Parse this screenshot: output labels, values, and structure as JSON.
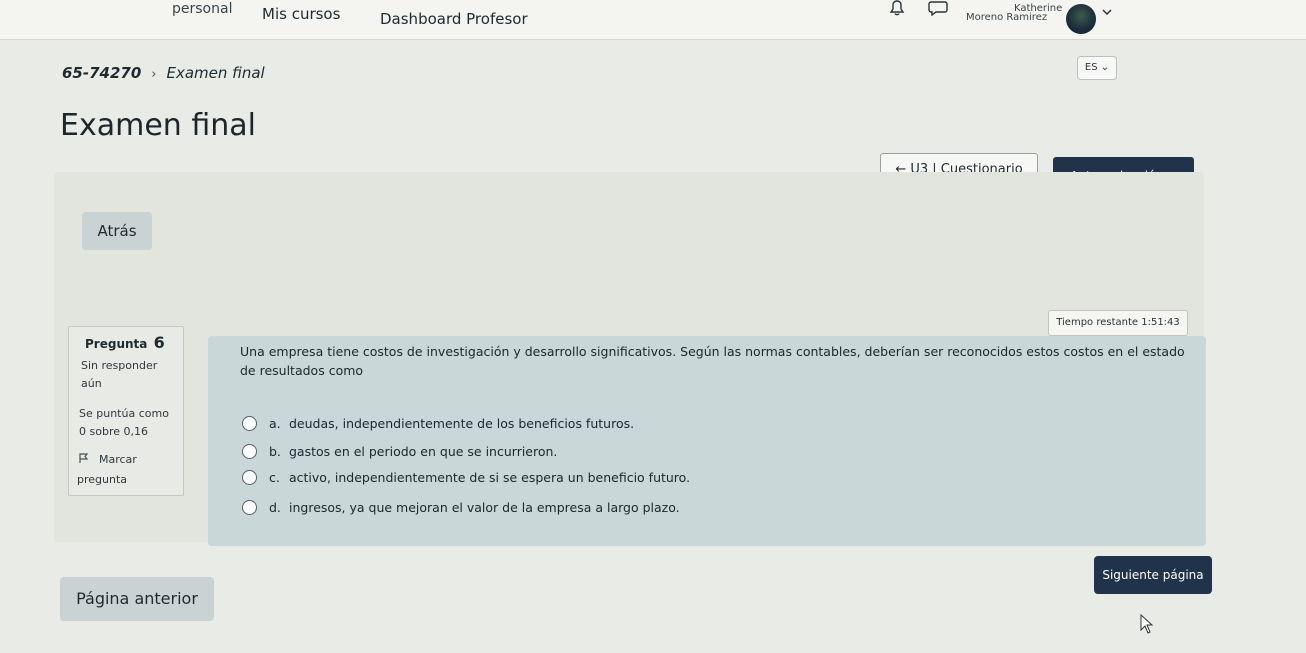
{
  "nav": {
    "personal_label": "personal",
    "cursos_label": "Mis cursos",
    "dashboard_label": "Dashboard Profesor",
    "user_first_name": "Katherine",
    "user_last_name": "Moreno Ramirez"
  },
  "lang": {
    "label": "ES ⌄"
  },
  "breadcrumb": {
    "course": "65-74270",
    "separator": "›",
    "current": "Examen final"
  },
  "page": {
    "title": "Examen final"
  },
  "activity_nav": {
    "prev_label": "← U3 | Cuestionario",
    "next_label": "Autoevaluación →"
  },
  "atras_label": "Atrás",
  "timer": {
    "text": "Tiempo restante 1:51:43"
  },
  "question": {
    "label": "Pregunta",
    "number": "6",
    "status_line1": "Sin responder",
    "status_line2": "aún",
    "grade_line1": "Se puntúa como",
    "grade_line2": "0 sobre 0,16",
    "flag_line1": "Marcar",
    "flag_line2": "pregunta",
    "text": "Una empresa tiene costos de investigación y desarrollo significativos. Según las normas contables, deberían ser reconocidos estos costos en el estado de resultados como",
    "options": [
      {
        "letter": "a.",
        "text": "deudas, independientemente de los beneficios futuros."
      },
      {
        "letter": "b.",
        "text": "gastos en el periodo en que se incurrieron."
      },
      {
        "letter": "c.",
        "text": "activo, independientemente de si se espera un beneficio futuro."
      },
      {
        "letter": "d.",
        "text": "ingresos, ya que mejoran el valor de la empresa a largo plazo."
      }
    ]
  },
  "pagination": {
    "prev_label": "Página anterior",
    "next_label": "Siguiente página"
  },
  "colors": {
    "primary_button": "#21334a",
    "secondary_button": "#c9d3d4",
    "question_body": "#c9d7d8"
  }
}
